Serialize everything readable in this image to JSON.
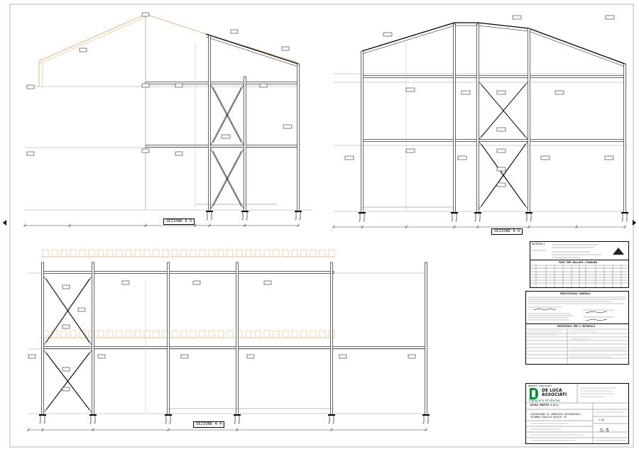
{
  "sections": {
    "s55": {
      "title": "SEZIONE 5-5"
    },
    "s66": {
      "title": "SEZIONE 6-6"
    },
    "s44": {
      "title": "SEZIONE 4-4"
    }
  },
  "notes": {
    "materials_title": "MATERIALI",
    "bolts_title": "FORI PER BULLONI STANDARD",
    "general_title": "PRESCRIZIONI GENERALI",
    "protection_title": "PROTEZIONI PER I MATERIALI"
  },
  "title_block": {
    "products_label": "PRODOTTI STRUTTURALI",
    "firm_name_1": "DE LUCA",
    "firm_name_2": "ASSOCIATI",
    "firm_subtitle": "Ingegneria strutturale",
    "client": "DIGIA PROFIN S.R.L.",
    "project_line_1": "COSTRUZIONE DI COMPLESSO RESIDENZIALE",
    "project_line_2": "SECONDO STRALCIO BLOCCO \"B\"",
    "drawing_sheet": "S-5",
    "scale": "1:50"
  }
}
